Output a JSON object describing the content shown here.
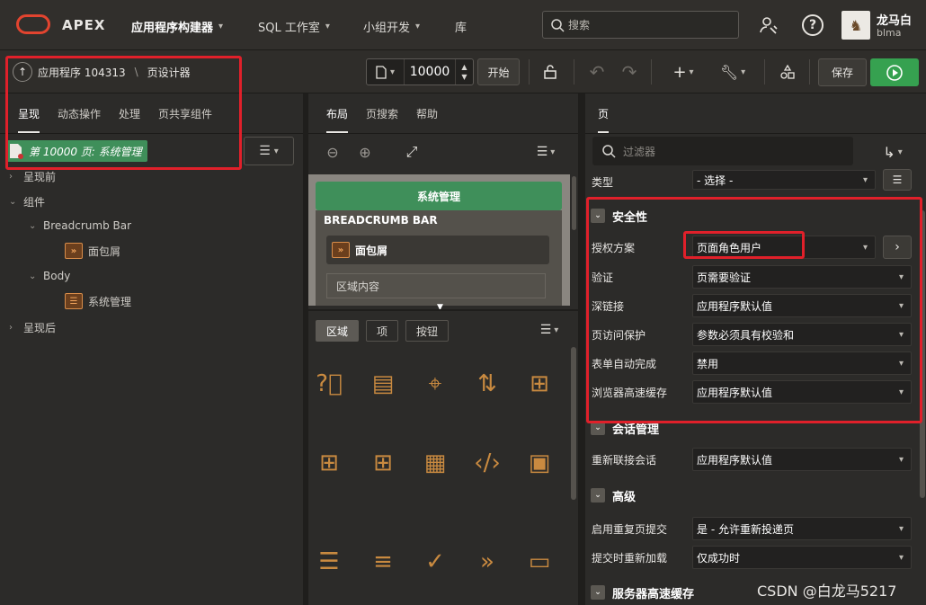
{
  "header": {
    "brand": "APEX",
    "menus": [
      {
        "label": "应用程序构建器",
        "bold": true
      },
      {
        "label": "SQL 工作室"
      },
      {
        "label": "小组开发"
      },
      {
        "label": "库"
      }
    ],
    "search_placeholder": "搜索",
    "user_name": "龙马白",
    "user_id": "blma"
  },
  "toolbar": {
    "app_label": "应用程序 104313",
    "separator": "\\",
    "page_designer": "页设计器",
    "page_number": "10000",
    "go_label": "开始",
    "save_label": "保存"
  },
  "left": {
    "tabs": [
      "呈现",
      "动态操作",
      "处理",
      "页共享组件"
    ],
    "page_badge": "第 10000 页: 系统管理",
    "tree": {
      "before": "呈现前",
      "components": "组件",
      "breadcrumb_bar": "Breadcrumb Bar",
      "breadcrumb_item": "面包屑",
      "body": "Body",
      "body_item": "系统管理",
      "after": "呈现后"
    }
  },
  "middle": {
    "tabs": [
      "布局",
      "页搜索",
      "帮助"
    ],
    "canvas": {
      "title_region": "系统管理",
      "breadcrumb_bar": "BREADCRUMB BAR",
      "breadcrumb_item": "面包屑",
      "region_content": "区域内容"
    },
    "gallery_tabs": [
      "区域",
      "项",
      "按钮"
    ]
  },
  "right": {
    "tab": "页",
    "filter_placeholder": "过滤器",
    "type_label": "类型",
    "type_value": "- 选择 -",
    "sections": {
      "security": "安全性",
      "session": "会话管理",
      "advanced": "高级",
      "server_cache": "服务器高速缓存"
    },
    "security_rows": [
      {
        "label": "授权方案",
        "value": "页面角色用户"
      },
      {
        "label": "验证",
        "value": "页需要验证"
      },
      {
        "label": "深链接",
        "value": "应用程序默认值"
      },
      {
        "label": "页访问保护",
        "value": "参数必须具有校验和"
      },
      {
        "label": "表单自动完成",
        "value": "禁用"
      },
      {
        "label": "浏览器高速缓存",
        "value": "应用程序默认值"
      }
    ],
    "session_rows": [
      {
        "label": "重新联接会话",
        "value": "应用程序默认值"
      }
    ],
    "advanced_rows": [
      {
        "label": "启用重复页提交",
        "value": "是 - 允许重新投递页"
      },
      {
        "label": "提交时重新加载",
        "value": "仅成功时"
      }
    ]
  },
  "watermark": "CSDN @白龙马5217",
  "colors": {
    "accent_red": "#e0202a",
    "run_green": "#36a150",
    "badge_green": "#3f8f5a",
    "icon_orange": "#c98a40"
  }
}
